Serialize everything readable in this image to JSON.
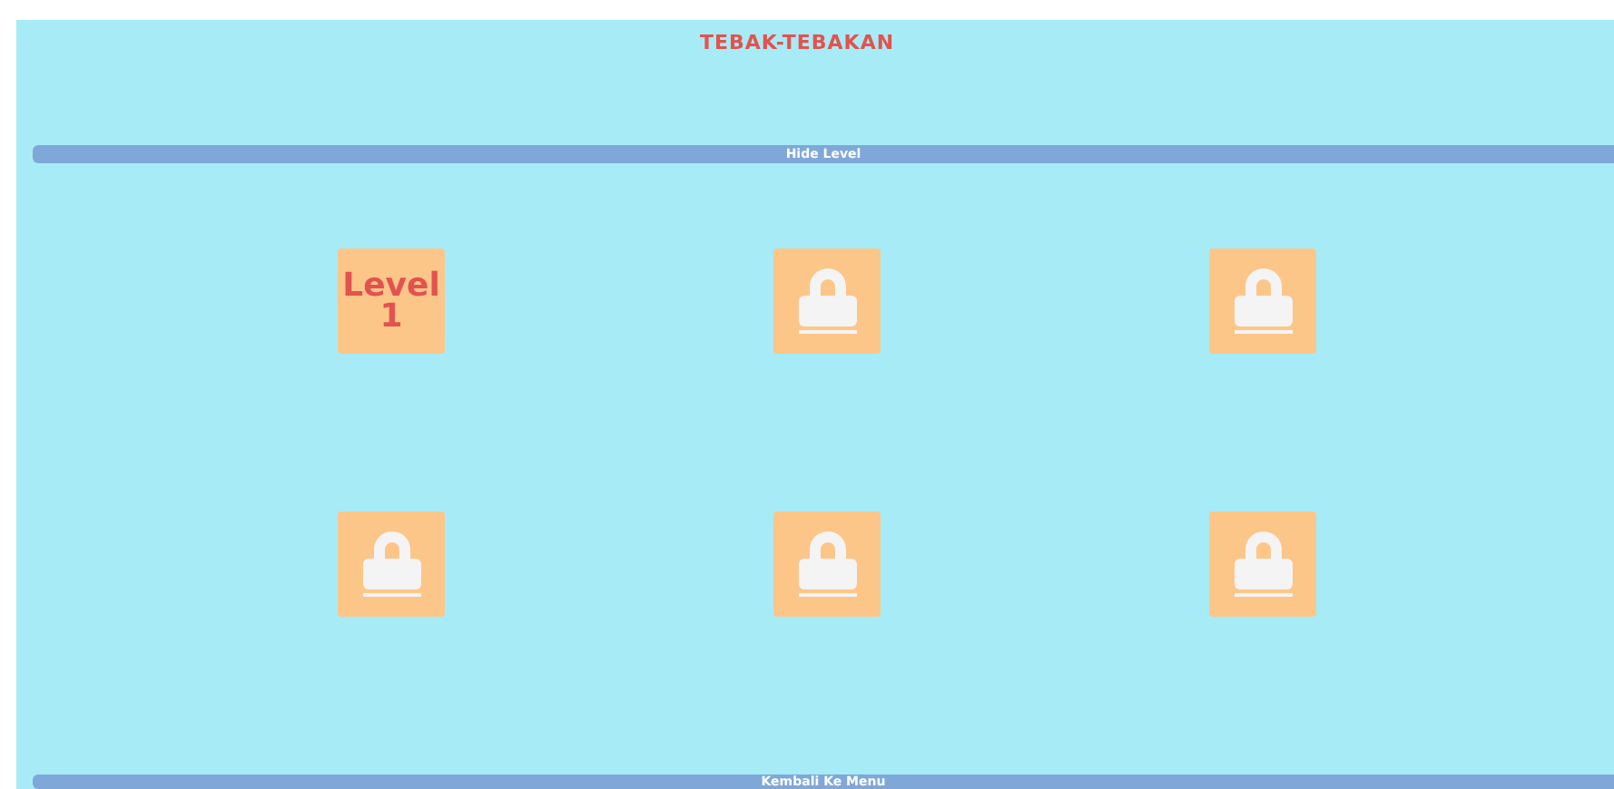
{
  "title": "TEBAK-TEBAKAN",
  "hide_button": "Hide Level",
  "levels": [
    {
      "locked": false,
      "label": "Level 1"
    },
    {
      "locked": true
    },
    {
      "locked": true
    },
    {
      "locked": true
    },
    {
      "locked": true
    },
    {
      "locked": true
    }
  ],
  "back_button": "Kembali Ke Menu"
}
